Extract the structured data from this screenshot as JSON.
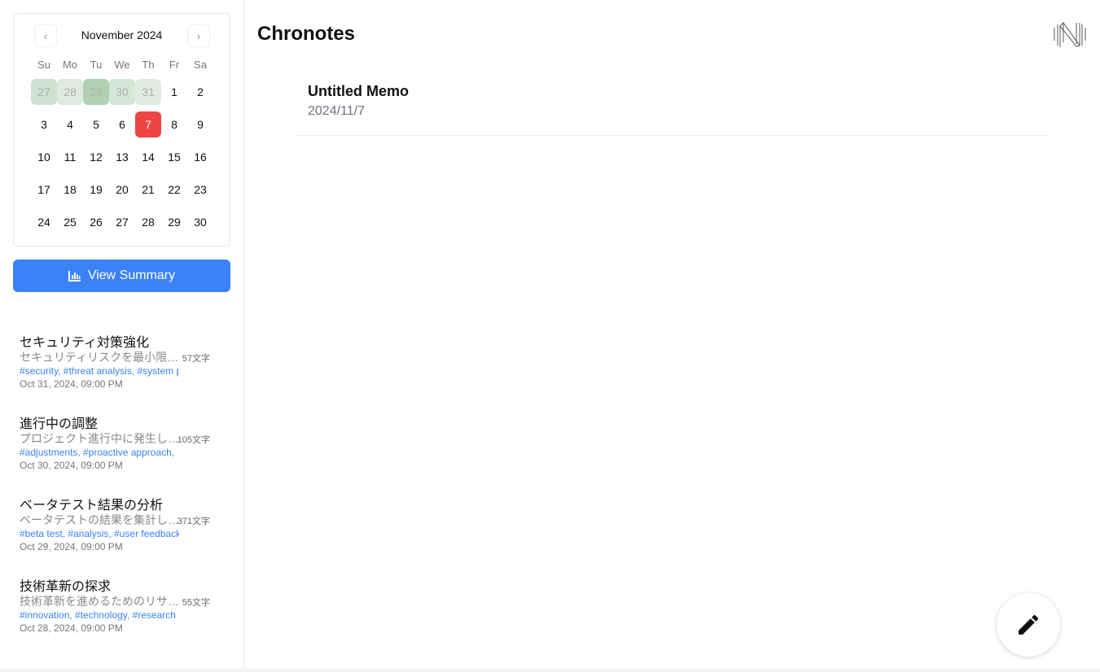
{
  "app": {
    "title": "Chronotes"
  },
  "calendar": {
    "month_label": "November 2024",
    "prev_icon": "chevron-left-icon",
    "next_icon": "chevron-right-icon",
    "weekdays": [
      "Su",
      "Mo",
      "Tu",
      "We",
      "Th",
      "Fr",
      "Sa"
    ],
    "weeks": [
      [
        "27",
        "28",
        "29",
        "30",
        "31",
        "1",
        "2"
      ],
      [
        "3",
        "4",
        "5",
        "6",
        "7",
        "8",
        "9"
      ],
      [
        "10",
        "11",
        "12",
        "13",
        "14",
        "15",
        "16"
      ],
      [
        "17",
        "18",
        "19",
        "20",
        "21",
        "22",
        "23"
      ],
      [
        "24",
        "25",
        "26",
        "27",
        "28",
        "29",
        "30"
      ]
    ],
    "outside_month_heat": {
      "27": "#cde3cf",
      "28": "#deebe0",
      "29": "#b0d1b2",
      "30": "#d5e7d7",
      "31": "#deebe0"
    },
    "selected": "7",
    "selected_color": "#ef4444"
  },
  "summary_button": {
    "label": "View Summary",
    "icon": "bar-chart-icon",
    "color": "#3b82f6"
  },
  "memos": [
    {
      "title": "セキュリティ対策強化",
      "preview": "セキュリティリスクを最小限に抑えるための",
      "count": "57文字",
      "tags": "#security, #threat analysis, #system protection",
      "date": "Oct 31, 2024, 09:00 PM"
    },
    {
      "title": "進行中の調整",
      "preview": "プロジェクト進行中に発生した問題への対応",
      "count": "105文字",
      "tags": "#adjustments, #proactive approach,",
      "date": "Oct 30, 2024, 09:00 PM"
    },
    {
      "title": "ベータテスト結果の分析",
      "preview": "ベータテストの結果を集計し分析しました",
      "count": "371文字",
      "tags": "#beta test, #analysis, #user feedback",
      "date": "Oct 29, 2024, 09:00 PM"
    },
    {
      "title": "技術革新の探求",
      "preview": "技術革新を進めるためのリサーチを実施",
      "count": "55文字",
      "tags": "#innovation, #technology, #research",
      "date": "Oct 28, 2024, 09:00 PM"
    }
  ],
  "main": {
    "entry": {
      "title": "Untitled Memo",
      "date": "2024/11/7"
    },
    "fab_icon": "pencil-icon",
    "logo_icon": "n-logo-icon"
  }
}
